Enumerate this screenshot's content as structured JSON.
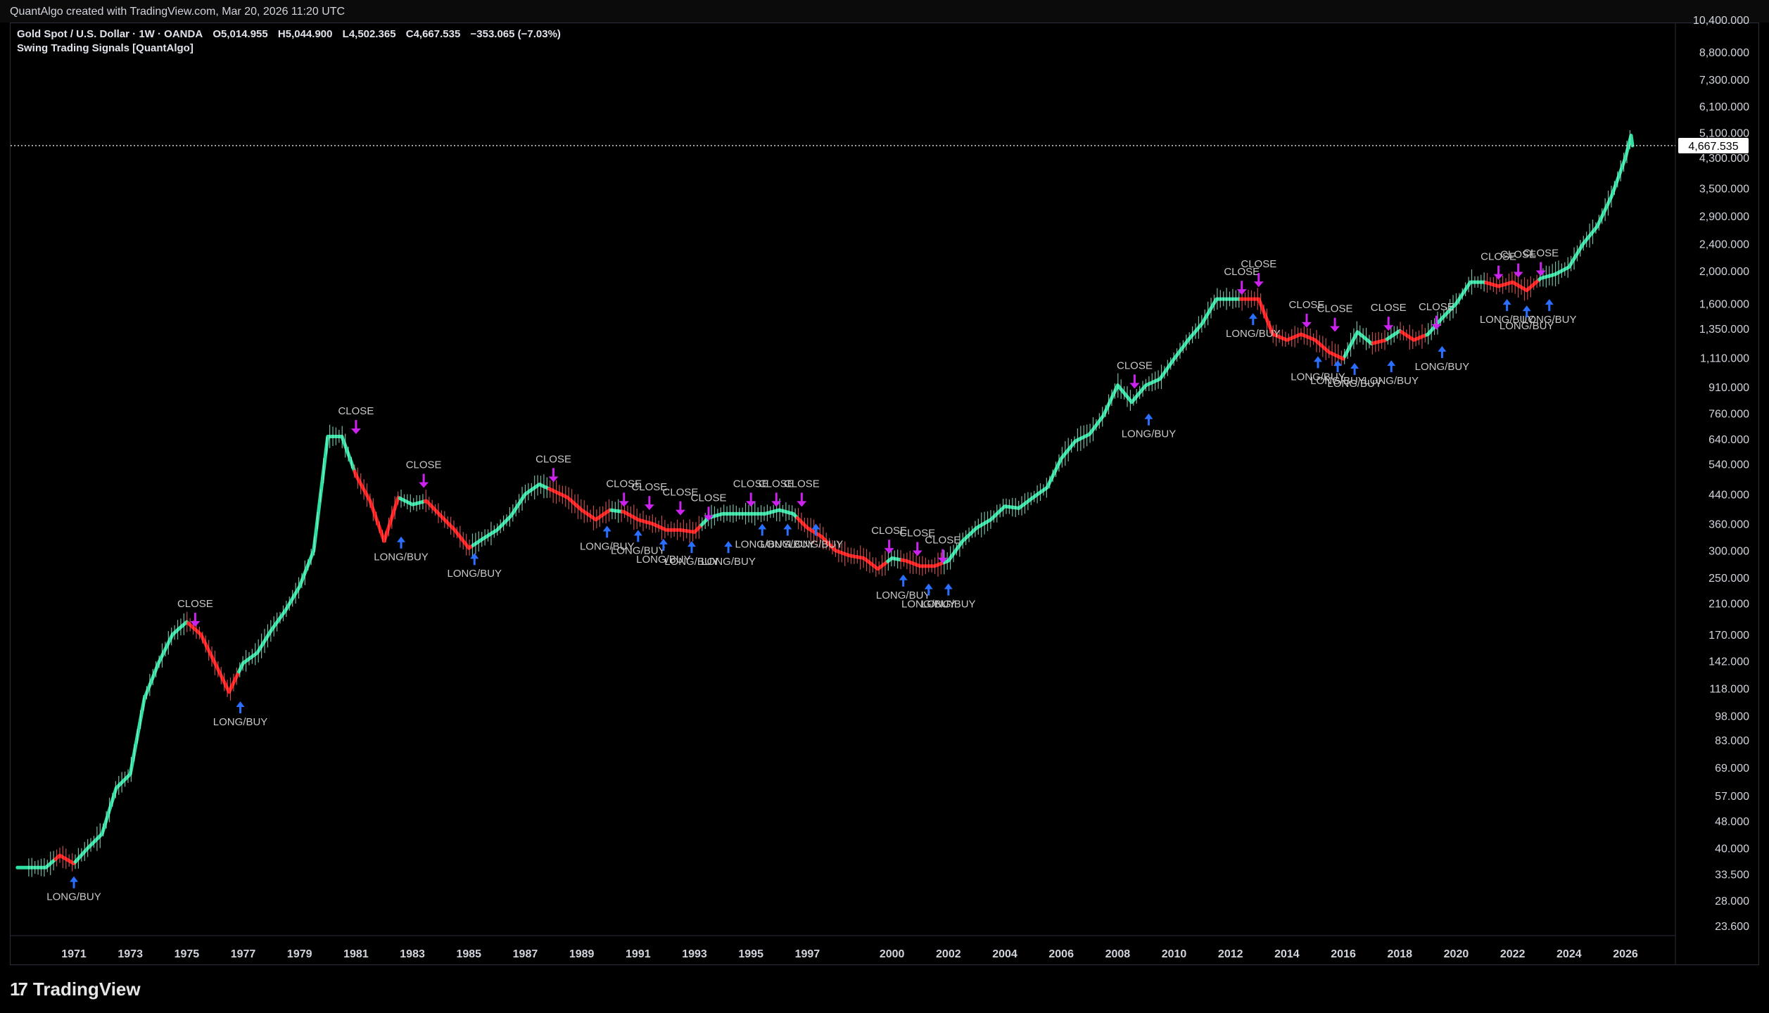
{
  "header": {
    "credit": "QuantAlgo created with TradingView.com, Mar 20, 2026 11:20 UTC"
  },
  "legend": {
    "symbol": "Gold Spot / U.S. Dollar · 1W · OANDA",
    "open": "O5,014.955",
    "high": "H5,044.900",
    "low": "L4,502.365",
    "close": "C4,667.535",
    "change": "−353.065 (−7.03%)",
    "indicator": "Swing Trading Signals [QuantAlgo]"
  },
  "footer": {
    "brand": "TradingView",
    "logo_text": "17"
  },
  "colors": {
    "background": "#000000",
    "uptrend": "#2ee0a0",
    "downtrend": "#ff1a1a",
    "close_signal": "#cc22ee",
    "long_signal": "#2a6fff",
    "signal_text": "#c8c8c8",
    "price_badge_bg": "#ffffff",
    "price_badge_text": "#000000",
    "axis_text": "#d1d4dc"
  },
  "chart_data": {
    "type": "line",
    "title": "Gold Spot / U.S. Dollar · 1W · OANDA",
    "y_scale": "log",
    "y_ticks": [
      "23.600",
      "28.000",
      "33.500",
      "40.000",
      "48.000",
      "57.000",
      "69.000",
      "83.000",
      "98.000",
      "118.000",
      "142.000",
      "170.000",
      "210.000",
      "250.000",
      "300.000",
      "360.000",
      "440.000",
      "540.000",
      "640.000",
      "760.000",
      "910.000",
      "1,110.000",
      "1,350.000",
      "1,600.000",
      "2,000.000",
      "2,400.000",
      "2,900.000",
      "3,500.000",
      "4,300.000",
      "5,100.000",
      "6,100.000",
      "7,300.000",
      "8,800.000"
    ],
    "y_tick_values": [
      23.6,
      28,
      33.5,
      40,
      48,
      57,
      69,
      83,
      98,
      118,
      142,
      170,
      210,
      250,
      300,
      360,
      440,
      540,
      640,
      760,
      910,
      1110,
      1350,
      1600,
      2000,
      2400,
      2900,
      3500,
      4300,
      5100,
      6100,
      7300,
      8800
    ],
    "x_ticks": [
      "1971",
      "1973",
      "1975",
      "1977",
      "1979",
      "1981",
      "1983",
      "1985",
      "1987",
      "1989",
      "1991",
      "1993",
      "1995",
      "1997",
      "2000",
      "2002",
      "2004",
      "2006",
      "2008",
      "2010",
      "2012",
      "2014",
      "2016",
      "2018",
      "2020",
      "2022",
      "2024",
      "2026"
    ],
    "x_tick_years": [
      1971,
      1973,
      1975,
      1977,
      1979,
      1981,
      1983,
      1985,
      1987,
      1989,
      1991,
      1993,
      1995,
      1997,
      2000,
      2002,
      2004,
      2006,
      2008,
      2010,
      2012,
      2014,
      2016,
      2018,
      2020,
      2022,
      2024,
      2026
    ],
    "last_price_label": "4,667.535",
    "last_price": 4667.535,
    "series": [
      {
        "points": [
          [
            1969.0,
            35
          ],
          [
            1970.0,
            35
          ],
          [
            1970.5,
            38
          ],
          [
            1971.0,
            36
          ],
          [
            1971.5,
            40
          ],
          [
            1972.0,
            44
          ],
          [
            1972.5,
            60
          ],
          [
            1973.0,
            66
          ],
          [
            1973.5,
            110
          ],
          [
            1974.0,
            140
          ],
          [
            1974.5,
            170
          ],
          [
            1975.0,
            185
          ],
          [
            1975.5,
            170
          ],
          [
            1976.0,
            140
          ],
          [
            1976.5,
            115
          ],
          [
            1977.0,
            140
          ],
          [
            1977.5,
            150
          ],
          [
            1978.0,
            175
          ],
          [
            1978.5,
            200
          ],
          [
            1979.0,
            235
          ],
          [
            1979.5,
            300
          ],
          [
            1980.0,
            650
          ],
          [
            1980.5,
            650
          ],
          [
            1981.0,
            500
          ],
          [
            1981.5,
            420
          ],
          [
            1982.0,
            320
          ],
          [
            1982.5,
            430
          ],
          [
            1983.0,
            410
          ],
          [
            1983.5,
            420
          ],
          [
            1984.0,
            380
          ],
          [
            1984.5,
            345
          ],
          [
            1985.0,
            305
          ],
          [
            1985.5,
            325
          ],
          [
            1986.0,
            345
          ],
          [
            1986.5,
            380
          ],
          [
            1987.0,
            440
          ],
          [
            1987.5,
            470
          ],
          [
            1988.0,
            450
          ],
          [
            1988.5,
            430
          ],
          [
            1989.0,
            395
          ],
          [
            1989.5,
            370
          ],
          [
            1990.0,
            395
          ],
          [
            1990.5,
            390
          ],
          [
            1991.0,
            370
          ],
          [
            1991.5,
            360
          ],
          [
            1992.0,
            345
          ],
          [
            1992.5,
            345
          ],
          [
            1993.0,
            340
          ],
          [
            1993.5,
            375
          ],
          [
            1994.0,
            385
          ],
          [
            1994.5,
            385
          ],
          [
            1995.0,
            385
          ],
          [
            1995.5,
            385
          ],
          [
            1996.0,
            395
          ],
          [
            1996.5,
            385
          ],
          [
            1997.0,
            350
          ],
          [
            1997.5,
            330
          ],
          [
            1998.0,
            300
          ],
          [
            1998.5,
            290
          ],
          [
            1999.0,
            285
          ],
          [
            1999.5,
            265
          ],
          [
            2000.0,
            285
          ],
          [
            2000.5,
            280
          ],
          [
            2001.0,
            270
          ],
          [
            2001.5,
            270
          ],
          [
            2002.0,
            280
          ],
          [
            2002.5,
            320
          ],
          [
            2003.0,
            350
          ],
          [
            2003.5,
            370
          ],
          [
            2004.0,
            405
          ],
          [
            2004.5,
            400
          ],
          [
            2005.0,
            430
          ],
          [
            2005.5,
            460
          ],
          [
            2006.0,
            560
          ],
          [
            2006.5,
            630
          ],
          [
            2007.0,
            660
          ],
          [
            2007.5,
            750
          ],
          [
            2008.0,
            920
          ],
          [
            2008.5,
            820
          ],
          [
            2009.0,
            920
          ],
          [
            2009.5,
            960
          ],
          [
            2010.0,
            1100
          ],
          [
            2010.5,
            1250
          ],
          [
            2011.0,
            1400
          ],
          [
            2011.5,
            1650
          ],
          [
            2012.0,
            1650
          ],
          [
            2012.5,
            1650
          ],
          [
            2013.0,
            1650
          ],
          [
            2013.5,
            1300
          ],
          [
            2014.0,
            1250
          ],
          [
            2014.5,
            1300
          ],
          [
            2015.0,
            1250
          ],
          [
            2015.5,
            1150
          ],
          [
            2016.0,
            1100
          ],
          [
            2016.5,
            1320
          ],
          [
            2017.0,
            1220
          ],
          [
            2017.5,
            1250
          ],
          [
            2018.0,
            1330
          ],
          [
            2018.5,
            1250
          ],
          [
            2019.0,
            1300
          ],
          [
            2019.5,
            1450
          ],
          [
            2020.0,
            1600
          ],
          [
            2020.5,
            1850
          ],
          [
            2021.0,
            1850
          ],
          [
            2021.5,
            1800
          ],
          [
            2022.0,
            1850
          ],
          [
            2022.5,
            1750
          ],
          [
            2023.0,
            1900
          ],
          [
            2023.5,
            1950
          ],
          [
            2024.0,
            2050
          ],
          [
            2024.5,
            2400
          ],
          [
            2025.0,
            2700
          ],
          [
            2025.5,
            3300
          ],
          [
            2026.0,
            4300
          ],
          [
            2026.2,
            5000
          ],
          [
            2026.25,
            4667
          ]
        ]
      }
    ],
    "trend": {
      "down_intervals": [
        [
          1970.3,
          1971.0
        ],
        [
          1975.0,
          1976.8
        ],
        [
          1980.9,
          1982.5
        ],
        [
          1983.4,
          1985.1
        ],
        [
          1987.8,
          1990.0
        ],
        [
          1990.4,
          1993.2
        ],
        [
          1996.6,
          1999.8
        ],
        [
          2000.3,
          2001.8
        ],
        [
          2012.3,
          2013.0
        ],
        [
          2013.0,
          2016.0
        ],
        [
          2017.0,
          2017.5
        ],
        [
          2018.0,
          2018.9
        ],
        [
          2021.0,
          2022.9
        ]
      ]
    },
    "signals": [
      {
        "type": "long",
        "year": 1971.0,
        "price": 33,
        "label": "LONG/BUY"
      },
      {
        "type": "close",
        "year": 1975.3,
        "price": 195,
        "label": "CLOSE"
      },
      {
        "type": "long",
        "year": 1976.9,
        "price": 108,
        "label": "LONG/BUY"
      },
      {
        "type": "close",
        "year": 1981.0,
        "price": 720,
        "label": "CLOSE"
      },
      {
        "type": "long",
        "year": 1982.6,
        "price": 330,
        "label": "LONG/BUY"
      },
      {
        "type": "close",
        "year": 1983.4,
        "price": 500,
        "label": "CLOSE"
      },
      {
        "type": "long",
        "year": 1985.2,
        "price": 295,
        "label": "LONG/BUY"
      },
      {
        "type": "close",
        "year": 1988.0,
        "price": 520,
        "label": "CLOSE"
      },
      {
        "type": "long",
        "year": 1989.9,
        "price": 355,
        "label": "LONG/BUY"
      },
      {
        "type": "close",
        "year": 1990.5,
        "price": 440,
        "label": "CLOSE"
      },
      {
        "type": "long",
        "year": 1991.0,
        "price": 345,
        "label": "LONG/BUY"
      },
      {
        "type": "close",
        "year": 1991.4,
        "price": 430,
        "label": "CLOSE"
      },
      {
        "type": "long",
        "year": 1991.9,
        "price": 325,
        "label": "LONG/BUY"
      },
      {
        "type": "close",
        "year": 1992.5,
        "price": 415,
        "label": "CLOSE"
      },
      {
        "type": "long",
        "year": 1992.9,
        "price": 320,
        "label": "LONG/BUY"
      },
      {
        "type": "close",
        "year": 1993.5,
        "price": 400,
        "label": "CLOSE"
      },
      {
        "type": "long",
        "year": 1994.2,
        "price": 320,
        "label": "LONG/BUY"
      },
      {
        "type": "close",
        "year": 1995.0,
        "price": 440,
        "label": "CLOSE"
      },
      {
        "type": "long",
        "year": 1995.4,
        "price": 360,
        "label": "LONG/BUY"
      },
      {
        "type": "close",
        "year": 1995.9,
        "price": 440,
        "label": "CLOSE"
      },
      {
        "type": "long",
        "year": 1996.3,
        "price": 360,
        "label": "LONG/BUY"
      },
      {
        "type": "close",
        "year": 1996.8,
        "price": 440,
        "label": "CLOSE"
      },
      {
        "type": "long",
        "year": 1997.3,
        "price": 360,
        "label": "LONG/BUY"
      },
      {
        "type": "close",
        "year": 1999.9,
        "price": 320,
        "label": "CLOSE"
      },
      {
        "type": "long",
        "year": 2000.4,
        "price": 255,
        "label": "LONG/BUY"
      },
      {
        "type": "close",
        "year": 2000.9,
        "price": 315,
        "label": "CLOSE"
      },
      {
        "type": "long",
        "year": 2001.3,
        "price": 240,
        "label": "LONG/BUY"
      },
      {
        "type": "close",
        "year": 2001.8,
        "price": 300,
        "label": "CLOSE"
      },
      {
        "type": "long",
        "year": 2002.0,
        "price": 240,
        "label": "LONG/BUY"
      },
      {
        "type": "close",
        "year": 2008.6,
        "price": 980,
        "label": "CLOSE"
      },
      {
        "type": "long",
        "year": 2009.1,
        "price": 760,
        "label": "LONG/BUY"
      },
      {
        "type": "close",
        "year": 2012.4,
        "price": 1850,
        "label": "CLOSE"
      },
      {
        "type": "long",
        "year": 2012.8,
        "price": 1500,
        "label": "LONG/BUY"
      },
      {
        "type": "close",
        "year": 2013.0,
        "price": 1950,
        "label": "CLOSE"
      },
      {
        "type": "close",
        "year": 2014.7,
        "price": 1480,
        "label": "CLOSE"
      },
      {
        "type": "long",
        "year": 2015.1,
        "price": 1120,
        "label": "LONG/BUY"
      },
      {
        "type": "close",
        "year": 2015.7,
        "price": 1440,
        "label": "CLOSE"
      },
      {
        "type": "long",
        "year": 2015.8,
        "price": 1090,
        "label": "LONG/BUY"
      },
      {
        "type": "long",
        "year": 2016.4,
        "price": 1070,
        "label": "LONG/BUY"
      },
      {
        "type": "close",
        "year": 2017.6,
        "price": 1450,
        "label": "CLOSE"
      },
      {
        "type": "long",
        "year": 2017.7,
        "price": 1090,
        "label": "LONG/BUY"
      },
      {
        "type": "close",
        "year": 2019.3,
        "price": 1460,
        "label": "CLOSE"
      },
      {
        "type": "long",
        "year": 2019.5,
        "price": 1200,
        "label": "LONG/BUY"
      },
      {
        "type": "close",
        "year": 2021.5,
        "price": 2050,
        "label": "CLOSE"
      },
      {
        "type": "long",
        "year": 2021.8,
        "price": 1650,
        "label": "LONG/BUY"
      },
      {
        "type": "close",
        "year": 2022.2,
        "price": 2080,
        "label": "CLOSE"
      },
      {
        "type": "long",
        "year": 2022.5,
        "price": 1580,
        "label": "LONG/BUY"
      },
      {
        "type": "close",
        "year": 2023.0,
        "price": 2100,
        "label": "CLOSE"
      },
      {
        "type": "long",
        "year": 2023.3,
        "price": 1650,
        "label": "LONG/BUY"
      }
    ]
  }
}
